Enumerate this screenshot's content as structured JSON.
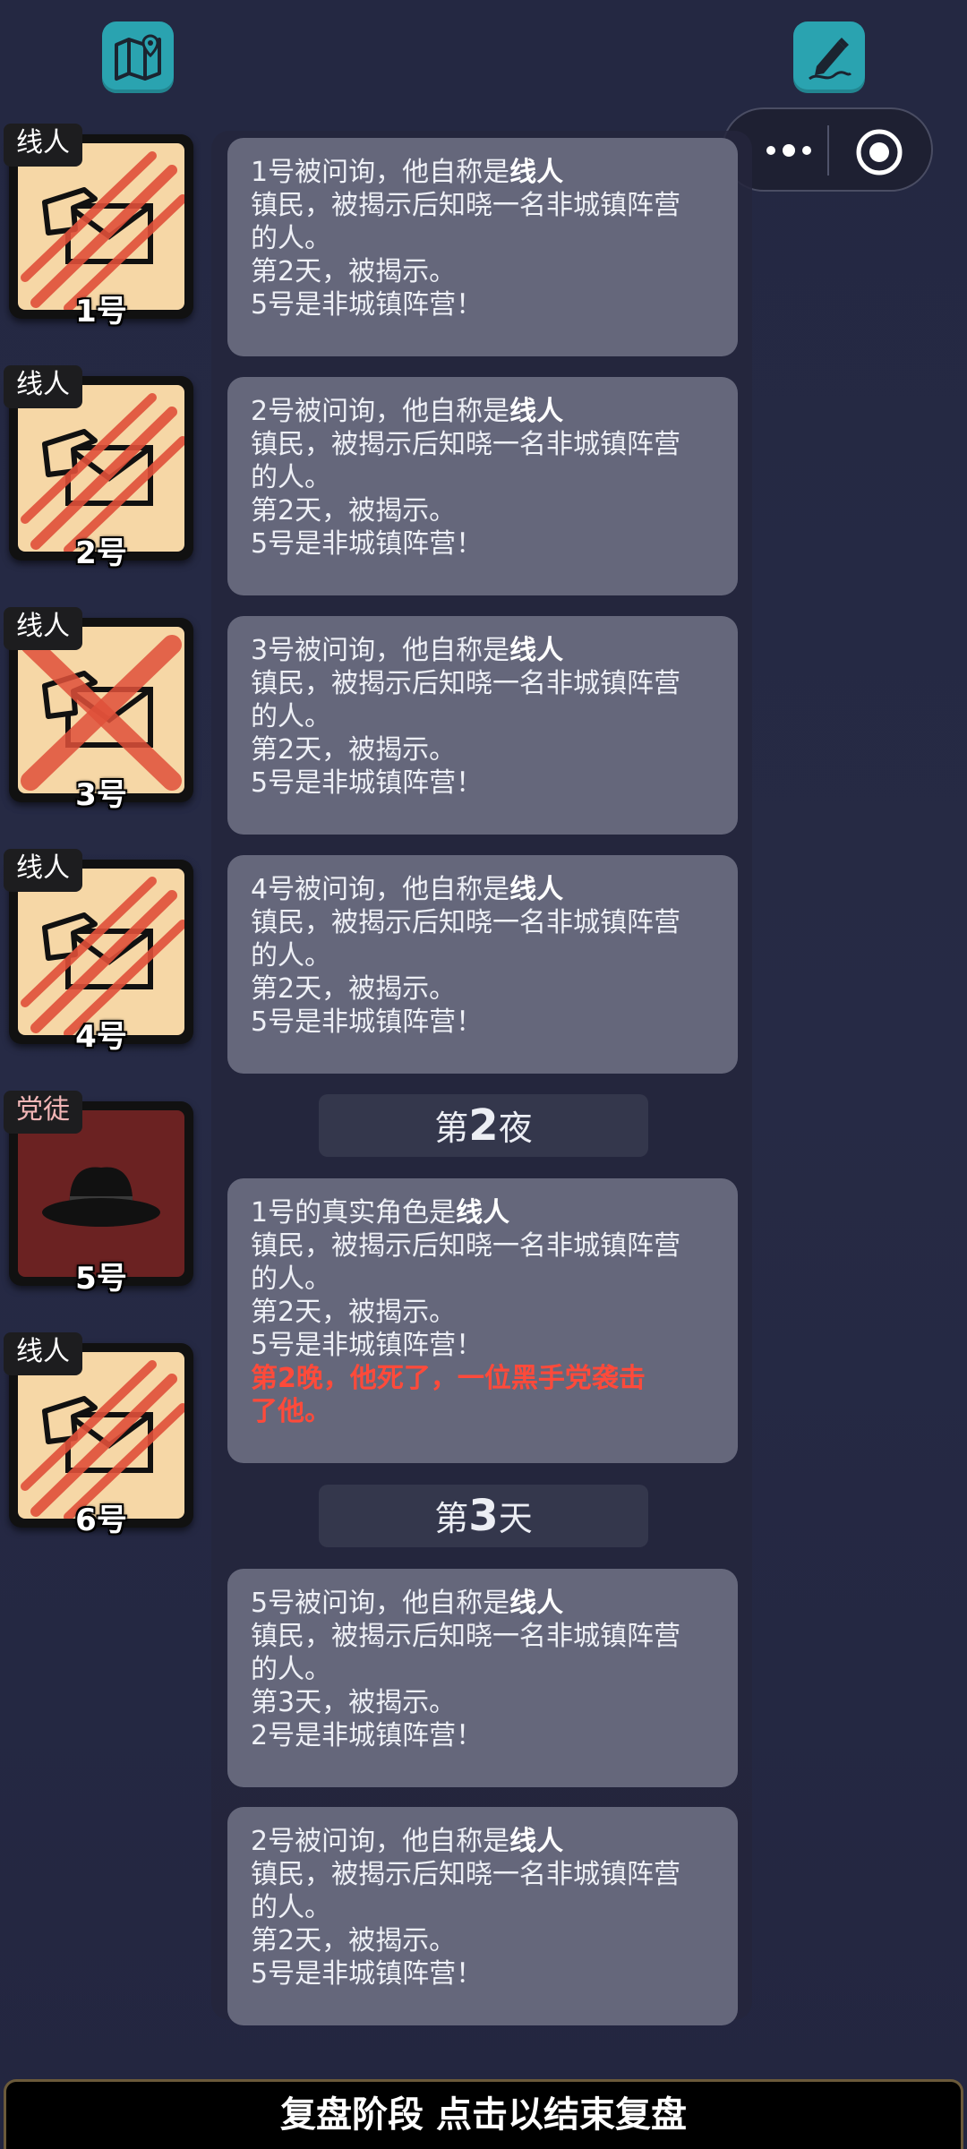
{
  "toolbar": {
    "map_icon": "map-pin-icon",
    "note_icon": "pen-edit-icon",
    "capsule": {
      "more_icon": "more-dots-icon",
      "close_icon": "target-circle-icon"
    }
  },
  "players": [
    {
      "role": "线人",
      "number": "1号",
      "state": "scratched"
    },
    {
      "role": "线人",
      "number": "2号",
      "state": "scratched"
    },
    {
      "role": "线人",
      "number": "3号",
      "state": "crossed-out"
    },
    {
      "role": "线人",
      "number": "4号",
      "state": "scratched"
    },
    {
      "role": "党徒",
      "number": "5号",
      "state": "hat"
    },
    {
      "role": "线人",
      "number": "6号",
      "state": "scratched"
    }
  ],
  "log": {
    "m1": {
      "prefix": "1号被问询，他自称是",
      "role": "线人",
      "l2": "镇民，被揭示后知晓一名非城镇阵营",
      "l3": "的人。",
      "l4": "第2天，被揭示。",
      "l5": "5号是非城镇阵营！"
    },
    "m2": {
      "prefix": "2号被问询，他自称是",
      "role": "线人",
      "l2": "镇民，被揭示后知晓一名非城镇阵营",
      "l3": "的人。",
      "l4": "第2天，被揭示。",
      "l5": "5号是非城镇阵营！"
    },
    "m3": {
      "prefix": "3号被问询，他自称是",
      "role": "线人",
      "l2": "镇民，被揭示后知晓一名非城镇阵营",
      "l3": "的人。",
      "l4": "第2天，被揭示。",
      "l5": "5号是非城镇阵营！"
    },
    "m4": {
      "prefix": "4号被问询，他自称是",
      "role": "线人",
      "l2": "镇民，被揭示后知晓一名非城镇阵营",
      "l3": "的人。",
      "l4": "第2天，被揭示。",
      "l5": "5号是非城镇阵营！"
    },
    "phase_night": {
      "pre": "第",
      "num": "2",
      "post": "夜"
    },
    "m5": {
      "prefix": "1号的真实角色是",
      "role": "线人",
      "l2": "镇民，被揭示后知晓一名非城镇阵营",
      "l3": "的人。",
      "l4": "第2天，被揭示。",
      "l5": "5号是非城镇阵营！",
      "death1": "第2晚，他死了，一位黑手党袭击",
      "death2": "了他。"
    },
    "phase_day": {
      "pre": "第",
      "num": "3",
      "post": "天"
    },
    "m6": {
      "prefix": "5号被问询，他自称是",
      "role": "线人",
      "l2": "镇民，被揭示后知晓一名非城镇阵营",
      "l3": "的人。",
      "l4": "第3天，被揭示。",
      "l5": "2号是非城镇阵营！"
    },
    "m7": {
      "prefix": "2号被问询，他自称是",
      "role": "线人",
      "l2": "镇民，被揭示后知晓一名非城镇阵营",
      "l3": "的人。",
      "l4": "第2天，被揭示。",
      "l5": "5号是非城镇阵营！"
    }
  },
  "footer": {
    "label": "复盘阶段 点击以结束复盘"
  },
  "colors": {
    "accent": "#2aa3b0",
    "card_bg": "#f6d7a6",
    "mafia_bg": "#6b2222",
    "death_text": "#ff4a3a"
  }
}
